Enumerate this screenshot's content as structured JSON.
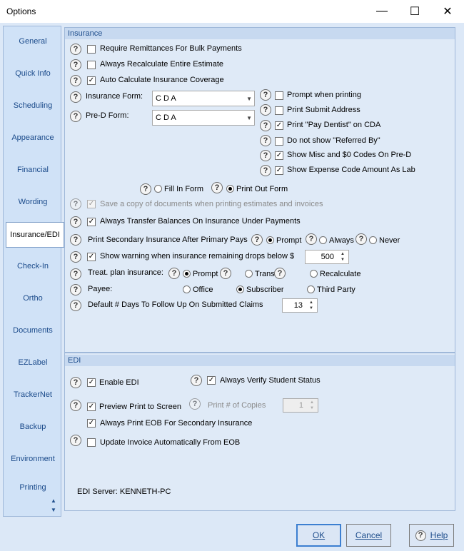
{
  "window": {
    "title": "Options",
    "minimize": "—",
    "maximize": "☐",
    "close": "✕"
  },
  "nav": {
    "items": [
      "General",
      "Quick Info",
      "Scheduling",
      "Appearance",
      "Financial",
      "Wording",
      "Insurance/EDI",
      "Check-In",
      "Ortho",
      "Documents",
      "EZLabel",
      "TrackerNet",
      "Backup",
      "Environment",
      "Printing"
    ],
    "selected": "Insurance/EDI"
  },
  "insurance": {
    "header": "Insurance",
    "help": "?",
    "require_remittances": "Require Remittances For Bulk Payments",
    "always_recalculate": "Always Recalculate Entire Estimate",
    "auto_calculate": "Auto Calculate Insurance Coverage",
    "insurance_form_label": "Insurance Form:",
    "insurance_form_value": "C D A",
    "pred_form_label": "Pre-D Form:",
    "pred_form_value": "C D A",
    "prompt_when_printing": "Prompt when printing",
    "print_submit_address": "Print Submit Address",
    "print_pay_dentist": "Print \"Pay Dentist\" on CDA",
    "do_not_show_referred": "Do not show \"Referred By\"",
    "show_misc_codes": "Show Misc and $0 Codes On Pre-D",
    "show_expense_code": "Show Expense Code Amount As Lab",
    "fill_in_form": "Fill In Form",
    "print_out_form": "Print Out Form",
    "save_copy": "Save a copy of documents when printing estimates and invoices",
    "always_transfer": "Always Transfer Balances On Insurance Under Payments",
    "print_secondary": "Print Secondary Insurance After Primary Pays",
    "opt_prompt": "Prompt",
    "opt_always": "Always",
    "opt_never": "Never",
    "show_warning": "Show warning when insurance remaining drops below $",
    "warning_value": "500",
    "treat_plan": "Treat. plan insurance:",
    "treat_prompt": "Prompt",
    "treat_trans": "Trans",
    "treat_recalc": "Recalculate",
    "payee": "Payee:",
    "payee_office": "Office",
    "payee_subscriber": "Subscriber",
    "payee_third": "Third Party",
    "default_days": "Default # Days To Follow Up On Submitted Claims",
    "default_days_value": "13"
  },
  "edi": {
    "header": "EDI",
    "enable_edi": "Enable EDI",
    "always_verify": "Always Verify Student Status",
    "preview_print": "Preview Print to Screen",
    "print_copies": "Print # of Copies",
    "copies_value": "1",
    "always_print_eob": "Always Print EOB For Secondary Insurance",
    "update_invoice": "Update Invoice Automatically From EOB",
    "server": "EDI Server: KENNETH-PC"
  },
  "buttons": {
    "ok": "OK",
    "cancel": "Cancel",
    "help": "Help"
  },
  "check": "✓"
}
